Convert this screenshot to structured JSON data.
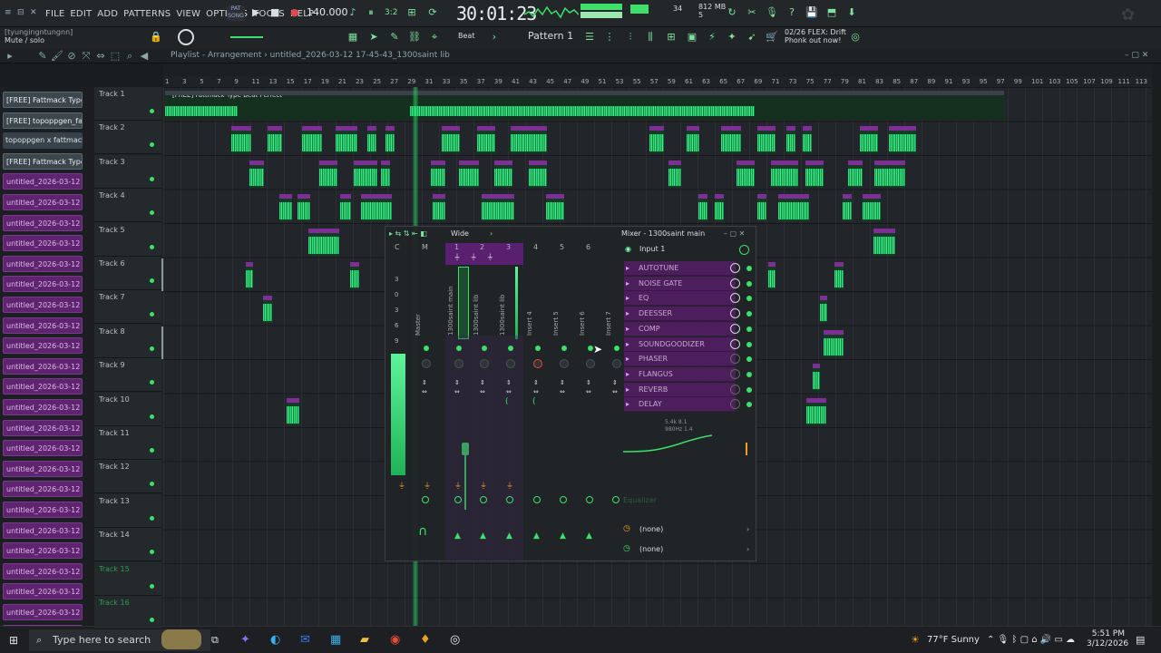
{
  "menu": [
    "FILE",
    "EDIT",
    "ADD",
    "PATTERNS",
    "VIEW",
    "OPTIONS",
    "TOOLS",
    "HELP"
  ],
  "song_pill": "SONG",
  "tempo": "140.000",
  "time_display": "30:01:23",
  "cpu": {
    "value": "34",
    "memory": "812 MB",
    "polyphony": "5"
  },
  "hint": {
    "line1": "[tyungingntungnn]",
    "line2": "Mute / solo"
  },
  "snap_label": "Beat",
  "pattern_label": "Pattern 1",
  "news": {
    "line1": "02/26  FLEX: Drift",
    "line2": "Phonk out now!"
  },
  "breadcrumb": "Playlist - Arrangement  ›  untitled_2026-03-12 17-45-43_1300saint lib",
  "ruler": [
    "1",
    "3",
    "5",
    "7",
    "9",
    "11",
    "13",
    "15",
    "17",
    "19",
    "21",
    "23",
    "25",
    "27",
    "29",
    "31",
    "33",
    "35",
    "37",
    "39",
    "41",
    "43",
    "45",
    "47",
    "49",
    "51",
    "53",
    "55",
    "57",
    "59",
    "61",
    "63",
    "65",
    "67",
    "69",
    "71",
    "73",
    "75",
    "77",
    "79",
    "81",
    "83",
    "85",
    "87",
    "89",
    "91",
    "93",
    "95",
    "97",
    "99",
    "101",
    "103",
    "105",
    "107",
    "109",
    "111",
    "113"
  ],
  "browser": [
    {
      "label": "[FREE] Fattmack Type Be...",
      "style": "sel"
    },
    {
      "label": "[FREE] topoppgen_fattm...",
      "style": "sel"
    },
    {
      "label": "topoppgen x fattmack ty...",
      "style": "plain"
    },
    {
      "label": "[FREE] Fattmack Type Be...",
      "style": "sel"
    },
    {
      "label": "untitled_2026-03-12 16-...",
      "style": "cl"
    },
    {
      "label": "untitled_2026-03-12 16-...",
      "style": "cl"
    },
    {
      "label": "untitled_2026-03-12 16-...",
      "style": "cl"
    },
    {
      "label": "untitled_2026-03-12 16-...",
      "style": "cl"
    },
    {
      "label": "untitled_2026-03-12 16-...",
      "style": "cl"
    },
    {
      "label": "untitled_2026-03-12 16-...",
      "style": "cl"
    },
    {
      "label": "untitled_2026-03-12 16-...",
      "style": "cl"
    },
    {
      "label": "untitled_2026-03-12 16-...",
      "style": "cl"
    },
    {
      "label": "untitled_2026-03-12 16-...",
      "style": "cl"
    },
    {
      "label": "untitled_2026-03-12 16-...",
      "style": "cl"
    },
    {
      "label": "untitled_2026-03-12 16-...",
      "style": "cl"
    },
    {
      "label": "untitled_2026-03-12 16-...",
      "style": "cl"
    },
    {
      "label": "untitled_2026-03-12 16-...",
      "style": "cl"
    },
    {
      "label": "untitled_2026-03-12 16-...",
      "style": "cl"
    },
    {
      "label": "untitled_2026-03-12 16-...",
      "style": "cl"
    },
    {
      "label": "untitled_2026-03-12 16-...",
      "style": "cl"
    },
    {
      "label": "untitled_2026-03-12 16-...",
      "style": "cl"
    },
    {
      "label": "untitled_2026-03-12 16-...",
      "style": "cl"
    },
    {
      "label": "untitled_2026-03-12 16-...",
      "style": "cl"
    },
    {
      "label": "untitled_2026-03-12 16-...",
      "style": "cl"
    },
    {
      "label": "untitled_2026-03-12 16-...",
      "style": "cl"
    },
    {
      "label": "untitled_2026-03-12 16-...",
      "style": "cl"
    },
    {
      "label": "untitled_2026-03-12 16-...",
      "style": "cl"
    }
  ],
  "tracks": [
    "Track 1",
    "Track 2",
    "Track 3",
    "Track 4",
    "Track 5",
    "Track 6",
    "Track 7",
    "Track 8",
    "Track 9",
    "Track 10",
    "Track 11",
    "Track 12",
    "Track 13",
    "Track 14",
    "Track 15",
    "Track 16"
  ],
  "track1_clip_label": "[FREE] Fattmack Type Beat Perfect",
  "clip_label": "unti..lib",
  "mixer": {
    "title": "Mixer - 1300saint main",
    "mode": "Wide",
    "input": "Input 1",
    "columns": [
      "C",
      "M",
      "1",
      "2",
      "3",
      "4",
      "5",
      "6"
    ],
    "strips": [
      "Master",
      "1300saint main",
      "1300saint lib",
      "1300saint lib",
      "Insert 4",
      "Insert 5",
      "Insert 6",
      "Insert 7"
    ],
    "db_marks": [
      "3",
      "0",
      "3",
      "6",
      "9"
    ],
    "effects": [
      "AUTOTUNE",
      "NOISE GATE",
      "EQ",
      "DEESSER",
      "COMP",
      "SOUNDGOODIZER",
      "PHASER",
      "FLANGUS",
      "REVERB",
      "DELAY"
    ],
    "eq_readout": "5.4k 8.1",
    "eq_readout2": "980Hz 1.4",
    "eq_label": "Equalizer",
    "send1": "(none)",
    "send2": "(none)"
  },
  "taskbar": {
    "search_placeholder": "Type here to search",
    "weather": "77°F  Sunny",
    "time": "5:51 PM",
    "date": "3/12/2026"
  }
}
